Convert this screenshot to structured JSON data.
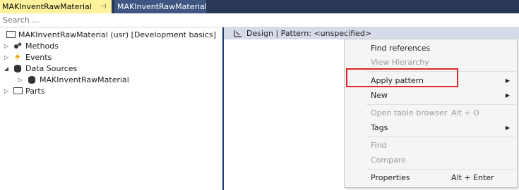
{
  "tabs": {
    "active_title": "MAKInventRawMaterial",
    "pin": "⊣",
    "close": "✕",
    "inactive_title": "MAKInventRawMaterial"
  },
  "search": {
    "placeholder": "Search ..."
  },
  "tree": {
    "root": "MAKInventRawMaterial (usr) [Development basics]",
    "methods": "Methods",
    "events": "Events",
    "data_sources": "Data Sources",
    "data_source_item": "MAKInventRawMaterial",
    "parts": "Parts"
  },
  "design": {
    "label": "Design | Pattern: <unspecified>"
  },
  "context_menu": {
    "find_references": "Find references",
    "view_hierarchy": "View Hierarchy",
    "apply_pattern": "Apply pattern",
    "new": "New",
    "open_table_browser": "Open table browser",
    "open_table_browser_shortcut": "Alt + O",
    "tags": "Tags",
    "find": "Find",
    "compare": "Compare",
    "properties": "Properties",
    "properties_shortcut": "Alt + Enter"
  },
  "colors": {
    "tab_active": "#fff29d",
    "tab_bar": "#293955",
    "highlight": "#e3242b",
    "events_icon": "#f0a30a"
  },
  "icons": [
    "pin-icon",
    "close-icon",
    "form-icon",
    "methods-icon",
    "events-icon",
    "datasource-icon",
    "parts-icon",
    "design-icon",
    "submenu-arrow-icon"
  ]
}
